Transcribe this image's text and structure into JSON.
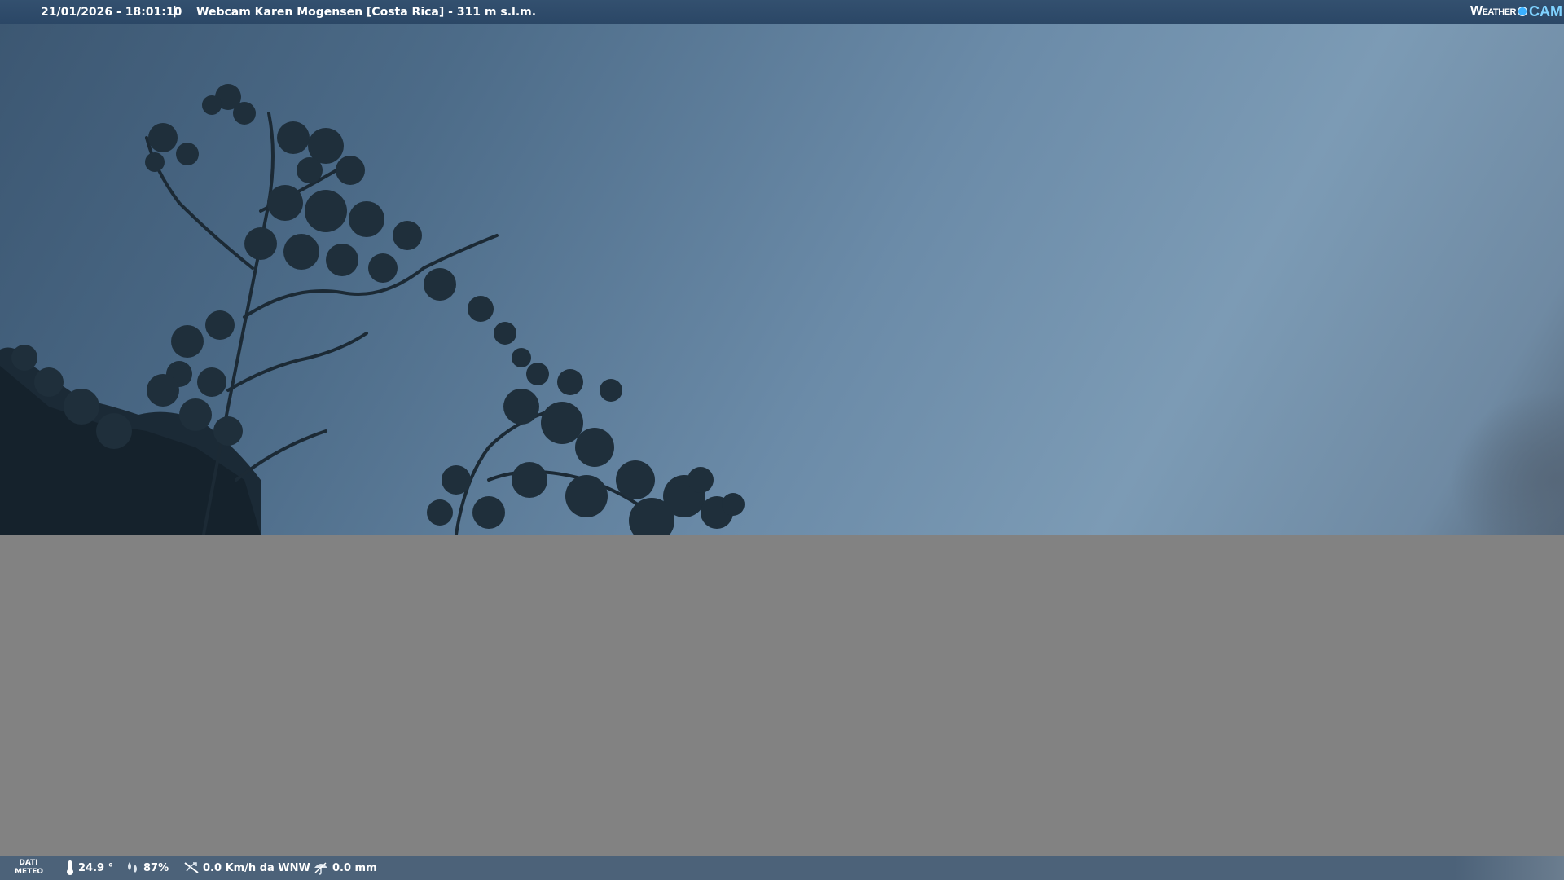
{
  "header": {
    "datetime": "21/01/2026 - 18:01:10",
    "separator": "|",
    "title": "Webcam Karen Mogensen [Costa Rica]  - 311 m s.l.m.",
    "brand_weather": "Weather",
    "brand_cam": "CAM"
  },
  "footer": {
    "dati_line1": "DATI",
    "dati_line2": "METEO",
    "temperature": "24.9 °",
    "humidity": "87%",
    "wind": "0.0 Km/h da WNW",
    "rain": "0.0 mm",
    "icons": [
      "thermometer-icon",
      "humidity-icon",
      "wind-icon",
      "rain-icon"
    ]
  },
  "colors": {
    "topbar": "#2b4766",
    "bottombar": "#4c6279",
    "gray": "#828282",
    "brand_accent": "#3ab0ff"
  }
}
